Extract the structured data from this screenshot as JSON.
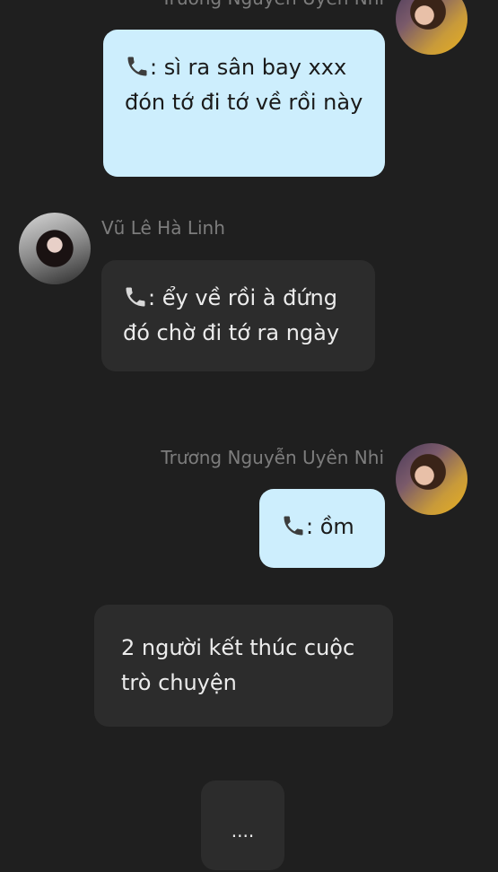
{
  "messages": [
    {
      "sender": "Trương Nguyễn Uyên Nhi",
      "text": ": sì ra sân bay xxx đón tớ đi tớ về rồi này"
    },
    {
      "sender": "Vũ Lê Hà Linh",
      "text": ": ểy về rồi à đứng đó chờ đi tớ ra ngày"
    },
    {
      "sender": "Trương Nguyễn Uyên Nhi",
      "text": ": ồm"
    }
  ],
  "system_message": "2 người kết thúc cuộc trò chuyện",
  "ellipsis": "....",
  "icons": {
    "phone": "phone-icon",
    "avatar_nhi": "avatar",
    "avatar_linh": "avatar"
  },
  "colors": {
    "background": "#1f1f1f",
    "my_bubble": "#cdeefd",
    "other_bubble": "#2c2c2c",
    "name_text": "#7d7d7d"
  }
}
